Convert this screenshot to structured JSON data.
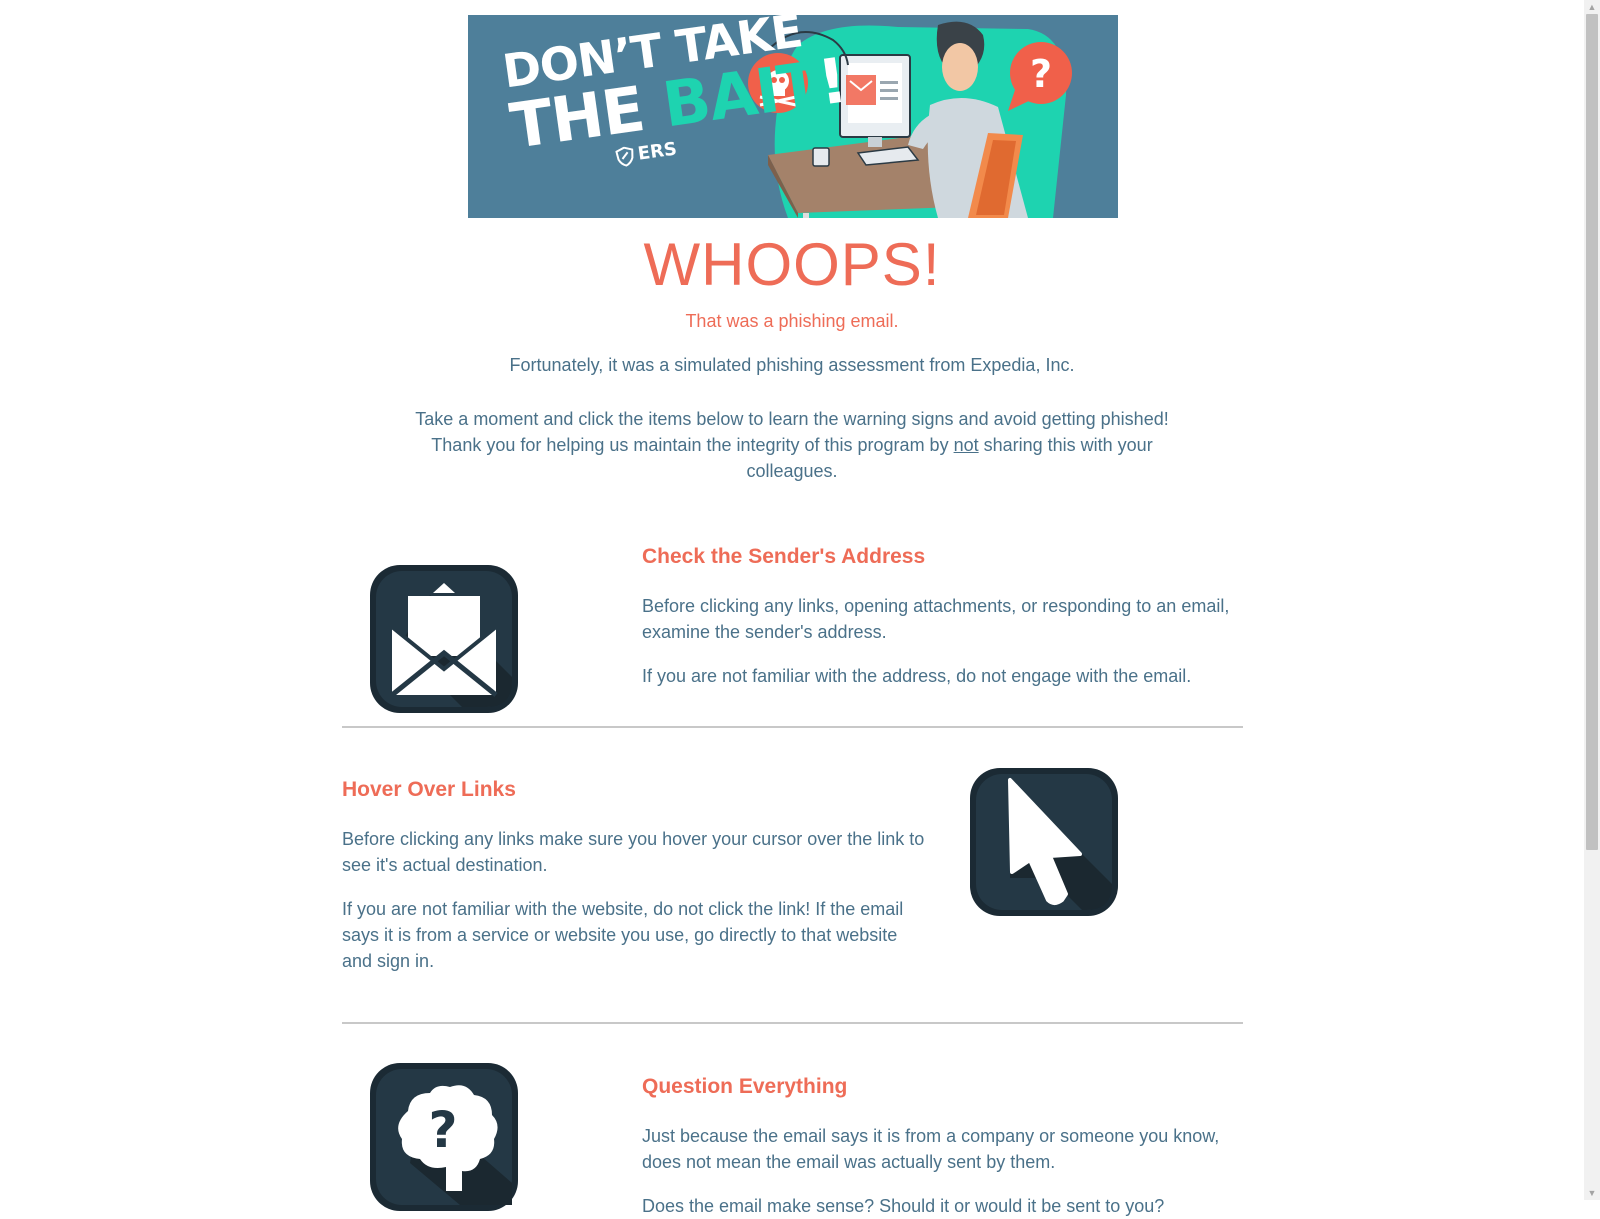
{
  "banner": {
    "line1": "DON’T TAKE",
    "line2_a": "THE",
    "line2_b": "BAIT",
    "line2_c": "!",
    "brand": "ERS",
    "colors": {
      "background": "#4e7f9a",
      "accent": "#1ed3b0",
      "warning": "#f0604a"
    }
  },
  "headline": "WHOOPS!",
  "subhead": "That was a phishing email.",
  "intro": "Fortunately, it was a simulated phishing assessment from Expedia, Inc.",
  "cta": {
    "line1": "Take a moment and click the items below to learn the warning signs and avoid getting phished!",
    "line2_before": "Thank you for helping us maintain the integrity of this program by ",
    "line2_emphasis": "not",
    "line2_after": " sharing this with your colleagues."
  },
  "sections": [
    {
      "title": "Check the Sender's Address",
      "icon": "open-envelope-icon",
      "paragraphs": [
        "Before clicking any links, opening attachments, or responding to an email, examine the sender's address.",
        "If you are not familiar with the address, do not engage with the email."
      ]
    },
    {
      "title": "Hover Over Links",
      "icon": "cursor-arrow-icon",
      "paragraphs": [
        "Before clicking any links make sure you hover your cursor over the link to see it's actual destination.",
        "If you are not familiar with the website, do not click the link! If the email says it is from a service or website you use, go directly to that website and sign in."
      ]
    },
    {
      "title": "Question Everything",
      "icon": "brain-question-icon",
      "paragraphs": [
        "Just because the email says it is from a company or someone you know, does not mean the email was actually sent by them.",
        "Does the email make sense? Should it or would it be sent to you?"
      ]
    }
  ],
  "colors": {
    "accent": "#ee6c57",
    "body_text": "#4a7189",
    "icon_tile": "#243845",
    "divider": "#c8c8c8"
  }
}
